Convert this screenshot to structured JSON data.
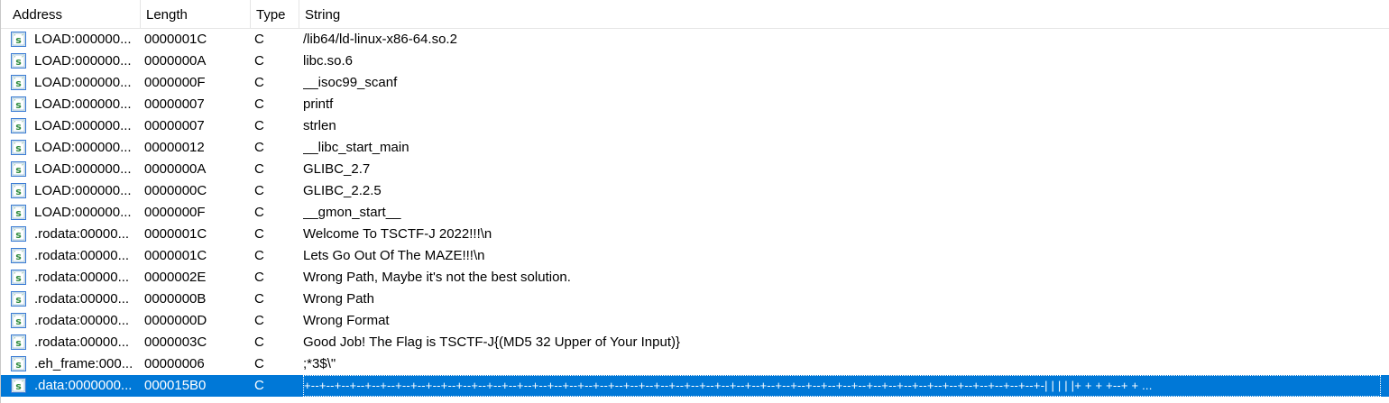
{
  "headers": {
    "address": "Address",
    "length": "Length",
    "type": "Type",
    "string": "String"
  },
  "row_icon": "string-literal-icon",
  "colors": {
    "selection": "#0078d7",
    "icon_green": "#2e8b3d",
    "icon_blue": "#3a7bd5"
  },
  "rows": [
    {
      "address": "LOAD:000000...",
      "length": "0000001C",
      "type": "C",
      "string": "/lib64/ld-linux-x86-64.so.2"
    },
    {
      "address": "LOAD:000000...",
      "length": "0000000A",
      "type": "C",
      "string": "libc.so.6"
    },
    {
      "address": "LOAD:000000...",
      "length": "0000000F",
      "type": "C",
      "string": "__isoc99_scanf"
    },
    {
      "address": "LOAD:000000...",
      "length": "00000007",
      "type": "C",
      "string": "printf"
    },
    {
      "address": "LOAD:000000...",
      "length": "00000007",
      "type": "C",
      "string": "strlen"
    },
    {
      "address": "LOAD:000000...",
      "length": "00000012",
      "type": "C",
      "string": "__libc_start_main"
    },
    {
      "address": "LOAD:000000...",
      "length": "0000000A",
      "type": "C",
      "string": "GLIBC_2.7"
    },
    {
      "address": "LOAD:000000...",
      "length": "0000000C",
      "type": "C",
      "string": "GLIBC_2.2.5"
    },
    {
      "address": "LOAD:000000...",
      "length": "0000000F",
      "type": "C",
      "string": "__gmon_start__"
    },
    {
      "address": ".rodata:00000...",
      "length": "0000001C",
      "type": "C",
      "string": "Welcome To TSCTF-J 2022!!!\\n"
    },
    {
      "address": ".rodata:00000...",
      "length": "0000001C",
      "type": "C",
      "string": "Lets Go Out Of The MAZE!!!\\n"
    },
    {
      "address": ".rodata:00000...",
      "length": "0000002E",
      "type": "C",
      "string": "Wrong Path, Maybe it's not the best solution."
    },
    {
      "address": ".rodata:00000...",
      "length": "0000000B",
      "type": "C",
      "string": "Wrong Path"
    },
    {
      "address": ".rodata:00000...",
      "length": "0000000D",
      "type": "C",
      "string": "Wrong Format"
    },
    {
      "address": ".rodata:00000...",
      "length": "0000003C",
      "type": "C",
      "string": "Good Job! The Flag is TSCTF-J{(MD5 32 Upper of Your Input)}"
    },
    {
      "address": ".eh_frame:000...",
      "length": "00000006",
      "type": "C",
      "string": ";*3$\\\""
    },
    {
      "address": ".data:0000000...",
      "length": "000015B0",
      "type": "C",
      "string": "+--+--+--+--+--+--+--+--+--+--+--+--+--+--+--+--+--+--+--+--+--+--+--+--+--+--+--+--+--+--+--+--+--+--+--+--+--+--+--+--+--+--+--+--+--+--+--+--+-|    |        |                                              |            |+  +  +  +--+  +  ...",
      "selected": true
    }
  ]
}
